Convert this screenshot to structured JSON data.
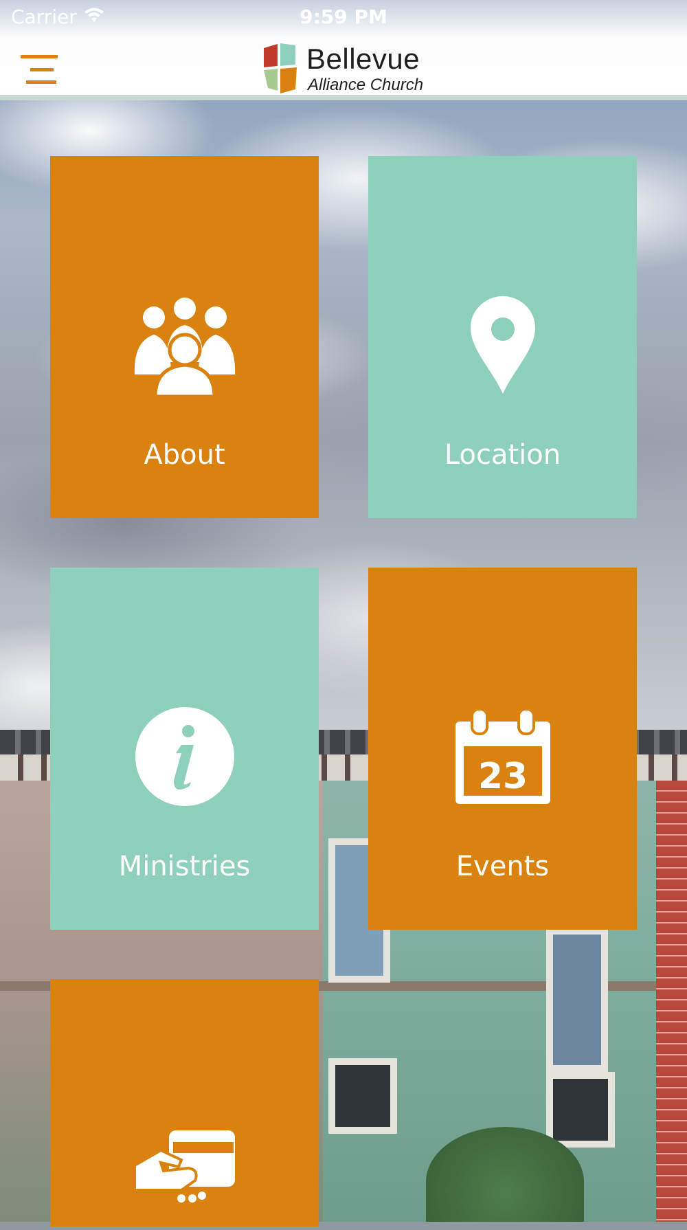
{
  "status_bar": {
    "carrier": "Carrier",
    "time": "9:59 PM",
    "wifi_icon": "wifi-icon"
  },
  "header": {
    "menu_icon": "menu-icon",
    "logo": {
      "name": "Bellevue",
      "subtitle": "Alliance Church"
    }
  },
  "tiles": [
    {
      "label": "About",
      "icon": "people-group-icon",
      "color": "#d9820f"
    },
    {
      "label": "Location",
      "icon": "map-pin-icon",
      "color": "#8fd0bd"
    },
    {
      "label": "Ministries",
      "icon": "info-icon",
      "color": "#8fd0bd"
    },
    {
      "label": "Events",
      "icon": "calendar-icon",
      "color": "#d9820f",
      "calendar_day": "23"
    },
    {
      "label": "",
      "icon": "card-in-hand-icon",
      "color": "#d9820f"
    }
  ],
  "colors": {
    "accent_orange": "#d9820f",
    "accent_teal": "#8fd0bd",
    "header_border": "#c9d8d2"
  }
}
